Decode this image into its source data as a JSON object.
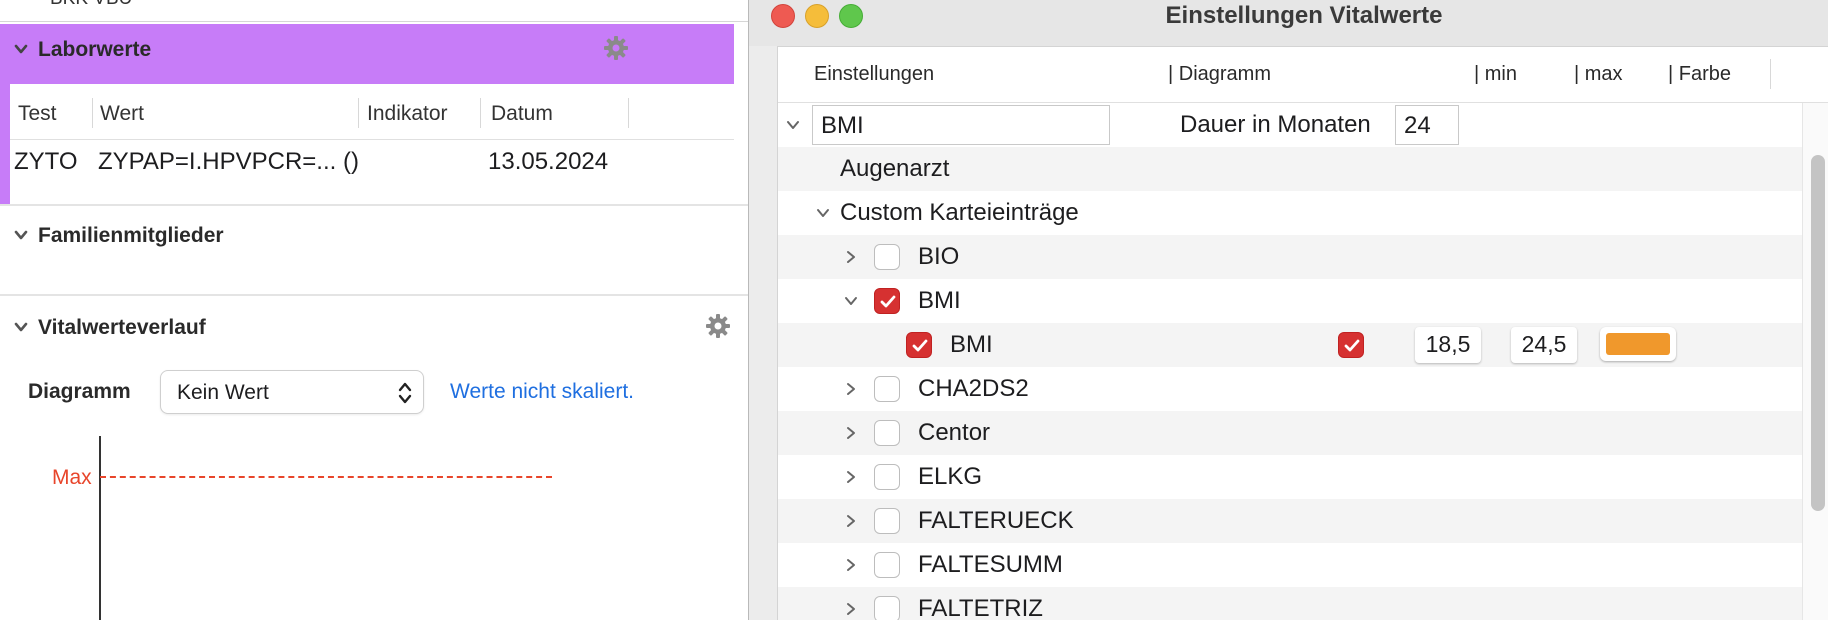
{
  "left_panel": {
    "top_cut_text": "BKK VBU",
    "lab": {
      "title": "Laborwerte",
      "columns": [
        "Test",
        "Wert",
        "Indikator",
        "Datum"
      ],
      "row": {
        "test": "ZYTO",
        "wert": "ZYPAP=I.HPVPCR=... ()",
        "indikator": "",
        "datum": "13.05.2024"
      }
    },
    "family": {
      "title": "Familienmitglieder"
    },
    "vital": {
      "title": "Vitalwerteverlauf",
      "diagram_label": "Diagramm",
      "select_value": "Kein Wert",
      "status_link": "Werte nicht skaliert.",
      "max_label": "Max"
    }
  },
  "window": {
    "title": "Einstellungen Vitalwerte",
    "columns": [
      "Einstellungen",
      "| Diagramm",
      "| min",
      "| max",
      "| Farbe"
    ],
    "bmi_field": "BMI",
    "duration_label": "Dauer in Monaten",
    "duration_value": "24",
    "rows": {
      "augenarzt": "Augenarzt",
      "custom": "Custom Karteieinträge",
      "bio": "BIO",
      "bmi_group": "BMI",
      "bmi_item": "BMI",
      "bmi_min": "18,5",
      "bmi_max": "24,5",
      "cha2ds2": "CHA2DS2",
      "centor": "Centor",
      "elkg": "ELKG",
      "falterueck": "FALTERUECK",
      "faltesumm": "FALTESUMM",
      "faltetriz": "FALTETRIZ"
    },
    "bmi_color": "#f0982c"
  },
  "colors": {
    "lab_accent": "#c77cf8",
    "checkbox_on": "#d63131",
    "link": "#1f6fe0",
    "max_line": "#e8452b"
  },
  "icons": [
    "chevron-down-icon",
    "gear-icon",
    "chevron-right-icon",
    "checkmark-icon",
    "updown-arrows-icon"
  ]
}
